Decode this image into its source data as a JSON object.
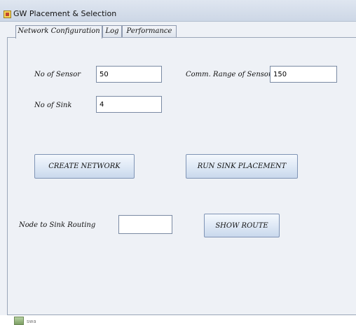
{
  "window": {
    "title": "GW Placement & Selection"
  },
  "tabs": [
    {
      "label": "Network Configuration",
      "active": true
    },
    {
      "label": "Log",
      "active": false
    },
    {
      "label": "Performance",
      "active": false
    }
  ],
  "form": {
    "no_of_sensor": {
      "label": "No of Sensor",
      "value": "50"
    },
    "comm_range": {
      "label": "Comm. Range of Sensor",
      "value": "150"
    },
    "no_of_sink": {
      "label": "No of Sink",
      "value": "4"
    },
    "routing": {
      "label": "Node to Sink Routing",
      "value": ""
    }
  },
  "buttons": {
    "create_network": "CREATE NETWORK",
    "run_sink_placement": "RUN SINK PLACEMENT",
    "show_route": "SHOW ROUTE"
  },
  "taskbar": {
    "text": "swa"
  },
  "icons": {
    "app": "java-cup-icon",
    "taskbar": "file-icon"
  }
}
